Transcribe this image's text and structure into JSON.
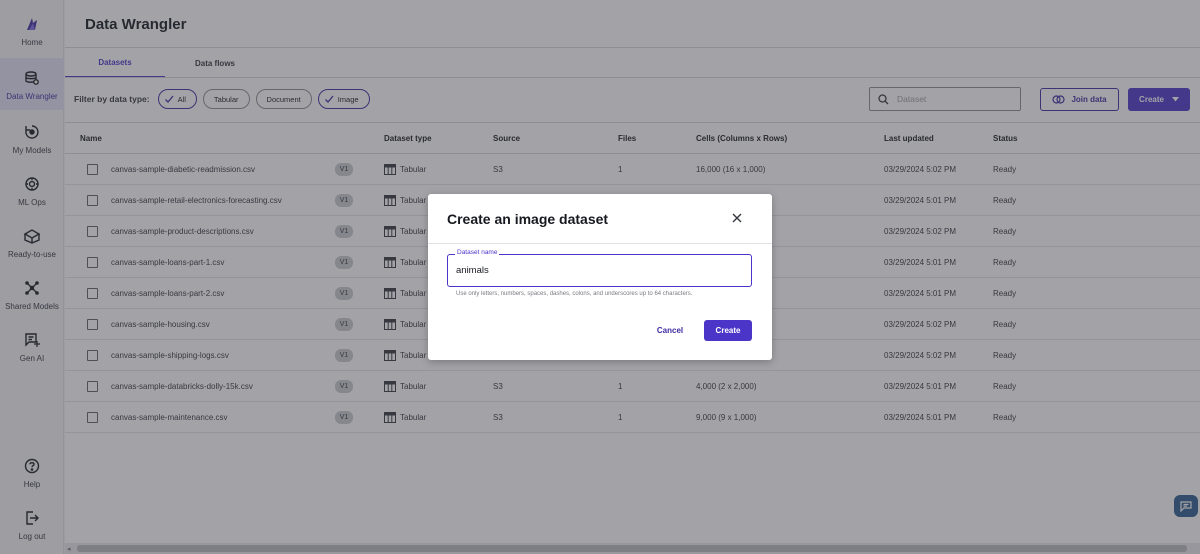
{
  "sidebar": {
    "items": [
      {
        "label": "Home",
        "icon": "canvas-logo-icon"
      },
      {
        "label": "Data Wrangler",
        "icon": "data-wrangler-icon"
      },
      {
        "label": "My Models",
        "icon": "models-icon"
      },
      {
        "label": "ML Ops",
        "icon": "mlops-icon"
      },
      {
        "label": "Ready-to-use",
        "icon": "ready-to-use-icon"
      },
      {
        "label": "Shared Models",
        "icon": "shared-models-icon"
      },
      {
        "label": "Gen AI",
        "icon": "gen-ai-icon"
      },
      {
        "label": "Help",
        "icon": "help-icon"
      },
      {
        "label": "Log out",
        "icon": "logout-icon"
      }
    ]
  },
  "header": {
    "title": "Data Wrangler"
  },
  "tabs": [
    {
      "label": "Datasets",
      "active": true
    },
    {
      "label": "Data flows",
      "active": false
    }
  ],
  "filter": {
    "label": "Filter by data type:",
    "chips": [
      {
        "label": "All",
        "selected": true
      },
      {
        "label": "Tabular",
        "selected": false
      },
      {
        "label": "Document",
        "selected": false
      },
      {
        "label": "Image",
        "selected": true
      }
    ]
  },
  "search": {
    "placeholder": "Dataset"
  },
  "actions": {
    "join_label": "Join data",
    "create_label": "Create"
  },
  "table": {
    "columns": [
      "Name",
      "Dataset type",
      "Source",
      "Files",
      "Cells (Columns x Rows)",
      "Last updated",
      "Status"
    ],
    "rows": [
      {
        "name": "canvas-sample-diabetic-readmission.csv",
        "version": "V1",
        "type": "Tabular",
        "source": "S3",
        "files": "1",
        "cells": "16,000 (16 x 1,000)",
        "updated": "03/29/2024 5:02 PM",
        "status": "Ready"
      },
      {
        "name": "canvas-sample-retail-electronics-forecasting.csv",
        "version": "V1",
        "type": "Tabular",
        "source": "",
        "files": "",
        "cells": "",
        "updated": "03/29/2024 5:01 PM",
        "status": "Ready"
      },
      {
        "name": "canvas-sample-product-descriptions.csv",
        "version": "V1",
        "type": "Tabular",
        "source": "",
        "files": "",
        "cells": "",
        "updated": "03/29/2024 5:02 PM",
        "status": "Ready"
      },
      {
        "name": "canvas-sample-loans-part-1.csv",
        "version": "V1",
        "type": "Tabular",
        "source": "",
        "files": "",
        "cells": "",
        "updated": "03/29/2024 5:01 PM",
        "status": "Ready"
      },
      {
        "name": "canvas-sample-loans-part-2.csv",
        "version": "V1",
        "type": "Tabular",
        "source": "",
        "files": "",
        "cells": "",
        "updated": "03/29/2024 5:01 PM",
        "status": "Ready"
      },
      {
        "name": "canvas-sample-housing.csv",
        "version": "V1",
        "type": "Tabular",
        "source": "",
        "files": "",
        "cells": "",
        "updated": "03/29/2024 5:02 PM",
        "status": "Ready"
      },
      {
        "name": "canvas-sample-shipping-logs.csv",
        "version": "V1",
        "type": "Tabular",
        "source": "",
        "files": "",
        "cells": "",
        "updated": "03/29/2024 5:02 PM",
        "status": "Ready"
      },
      {
        "name": "canvas-sample-databricks-dolly-15k.csv",
        "version": "V1",
        "type": "Tabular",
        "source": "S3",
        "files": "1",
        "cells": "4,000 (2 x 2,000)",
        "updated": "03/29/2024 5:01 PM",
        "status": "Ready"
      },
      {
        "name": "canvas-sample-maintenance.csv",
        "version": "V1",
        "type": "Tabular",
        "source": "S3",
        "files": "1",
        "cells": "9,000 (9 x 1,000)",
        "updated": "03/29/2024 5:01 PM",
        "status": "Ready"
      }
    ]
  },
  "modal": {
    "title": "Create an image dataset",
    "field_label": "Dataset name",
    "field_value": "animals",
    "helper": "Use only letters, numbers, spaces, dashes, colons, and underscores up to 64 characters.",
    "cancel_label": "Cancel",
    "create_label": "Create"
  },
  "colors": {
    "accent": "#4a35c8",
    "accent_dark": "#3d2c9f",
    "chat": "#2e5c8f"
  }
}
